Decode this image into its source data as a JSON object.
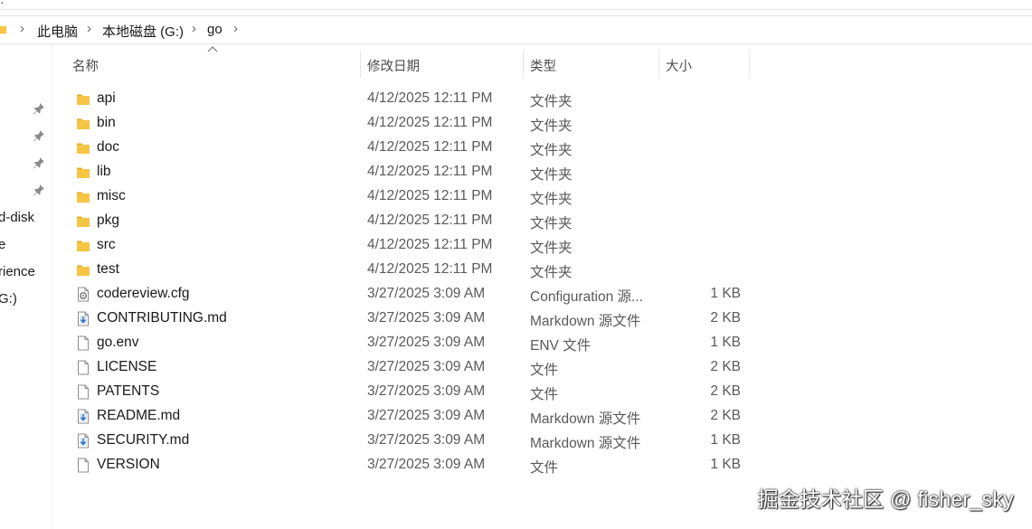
{
  "top_strip": {
    "glyph": "·"
  },
  "breadcrumb": {
    "items": [
      "此电脑",
      "本地磁盘 (G:)",
      "go"
    ]
  },
  "nav_pane": {
    "labels": [
      "d-disk",
      "e",
      "rience",
      "G:)"
    ]
  },
  "columns": {
    "name": "名称",
    "date": "修改日期",
    "type": "类型",
    "size": "大小"
  },
  "files": [
    {
      "name": "api",
      "date": "4/12/2025 12:11 PM",
      "type": "文件夹",
      "size": "",
      "icon": "folder-icon"
    },
    {
      "name": "bin",
      "date": "4/12/2025 12:11 PM",
      "type": "文件夹",
      "size": "",
      "icon": "folder-icon"
    },
    {
      "name": "doc",
      "date": "4/12/2025 12:11 PM",
      "type": "文件夹",
      "size": "",
      "icon": "folder-icon"
    },
    {
      "name": "lib",
      "date": "4/12/2025 12:11 PM",
      "type": "文件夹",
      "size": "",
      "icon": "folder-icon"
    },
    {
      "name": "misc",
      "date": "4/12/2025 12:11 PM",
      "type": "文件夹",
      "size": "",
      "icon": "folder-icon"
    },
    {
      "name": "pkg",
      "date": "4/12/2025 12:11 PM",
      "type": "文件夹",
      "size": "",
      "icon": "folder-icon"
    },
    {
      "name": "src",
      "date": "4/12/2025 12:11 PM",
      "type": "文件夹",
      "size": "",
      "icon": "folder-icon"
    },
    {
      "name": "test",
      "date": "4/12/2025 12:11 PM",
      "type": "文件夹",
      "size": "",
      "icon": "folder-icon"
    },
    {
      "name": "codereview.cfg",
      "date": "3/27/2025 3:09 AM",
      "type": "Configuration 源...",
      "size": "1 KB",
      "icon": "config-file-icon"
    },
    {
      "name": "CONTRIBUTING.md",
      "date": "3/27/2025 3:09 AM",
      "type": "Markdown 源文件",
      "size": "2 KB",
      "icon": "markdown-file-icon"
    },
    {
      "name": "go.env",
      "date": "3/27/2025 3:09 AM",
      "type": "ENV 文件",
      "size": "1 KB",
      "icon": "file-icon"
    },
    {
      "name": "LICENSE",
      "date": "3/27/2025 3:09 AM",
      "type": "文件",
      "size": "2 KB",
      "icon": "file-icon"
    },
    {
      "name": "PATENTS",
      "date": "3/27/2025 3:09 AM",
      "type": "文件",
      "size": "2 KB",
      "icon": "file-icon"
    },
    {
      "name": "README.md",
      "date": "3/27/2025 3:09 AM",
      "type": "Markdown 源文件",
      "size": "2 KB",
      "icon": "markdown-file-icon"
    },
    {
      "name": "SECURITY.md",
      "date": "3/27/2025 3:09 AM",
      "type": "Markdown 源文件",
      "size": "1 KB",
      "icon": "markdown-file-icon"
    },
    {
      "name": "VERSION",
      "date": "3/27/2025 3:09 AM",
      "type": "文件",
      "size": "1 KB",
      "icon": "file-icon"
    }
  ],
  "watermark": "掘金技术社区 @ fisher_sky",
  "colors": {
    "folder": "#f6c544",
    "folder_tab": "#e2a920",
    "markdown_arrow": "#2b6fc4",
    "text": "#1a1a1a",
    "muted": "#5a5a5a"
  }
}
